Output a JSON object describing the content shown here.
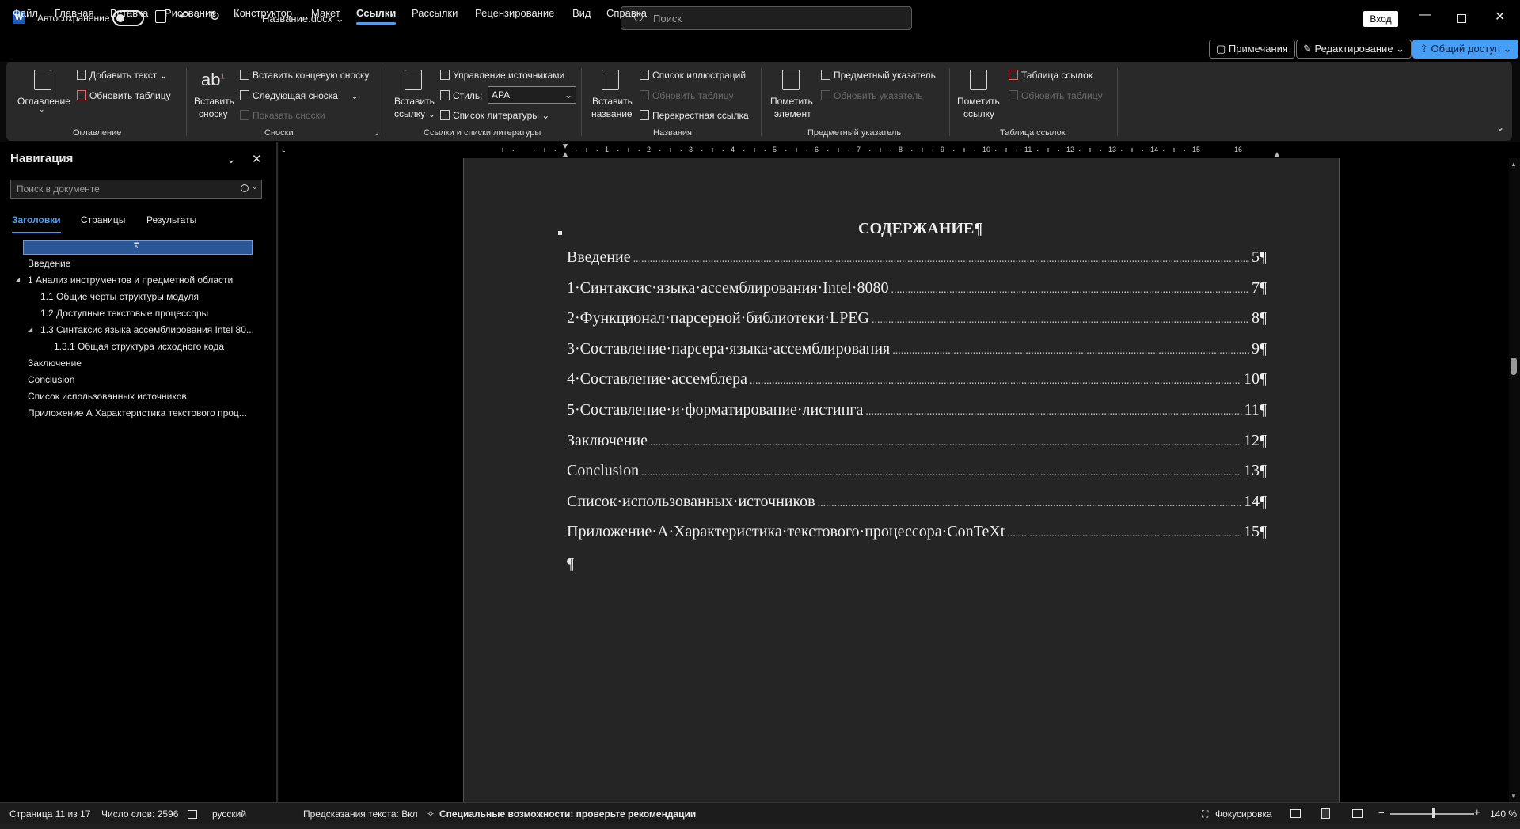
{
  "titlebar": {
    "logo": "W",
    "autosave_label": "Автосохранение",
    "doc_name": "Название.docx",
    "search_placeholder": "Поиск",
    "login": "Вход"
  },
  "menu": {
    "items": [
      "Файл",
      "Главная",
      "Вставка",
      "Рисование",
      "Конструктор",
      "Макет",
      "Ссылки",
      "Рассылки",
      "Рецензирование",
      "Вид",
      "Справка"
    ],
    "active": "Ссылки",
    "comments": "Примечания",
    "editing": "Редактирование",
    "share": "Общий доступ"
  },
  "ribbon": {
    "toc": {
      "big": "Оглавление",
      "add_text": "Добавить текст",
      "update": "Обновить таблицу",
      "group": "Оглавление"
    },
    "footnotes": {
      "insert_1": "Вставить",
      "insert_2": "сноску",
      "endnote": "Вставить концевую сноску",
      "next": "Следующая сноска",
      "show": "Показать сноски",
      "group": "Сноски"
    },
    "citations": {
      "insert_1": "Вставить",
      "insert_2": "ссылку",
      "manage": "Управление источниками",
      "style_label": "Стиль:",
      "style_value": "APA",
      "bibliography": "Список литературы",
      "group": "Ссылки и списки литературы"
    },
    "captions": {
      "insert_1": "Вставить",
      "insert_2": "название",
      "figures": "Список иллюстраций",
      "update": "Обновить таблицу",
      "cross": "Перекрестная ссылка",
      "group": "Названия"
    },
    "index": {
      "mark_1": "Пометить",
      "mark_2": "элемент",
      "insert": "Предметный указатель",
      "update": "Обновить указатель",
      "group": "Предметный указатель"
    },
    "toa": {
      "mark_1": "Пометить",
      "mark_2": "ссылку",
      "insert": "Таблица ссылок",
      "update": "Обновить таблицу",
      "group": "Таблица ссылок"
    }
  },
  "nav": {
    "title": "Навигация",
    "search_placeholder": "Поиск в документе",
    "tabs": [
      "Заголовки",
      "Страницы",
      "Результаты"
    ],
    "items": [
      {
        "label": "Введение"
      },
      {
        "label": "1 Анализ инструментов и предметной области"
      },
      {
        "label": "1.1 Общие черты структуры модуля"
      },
      {
        "label": "1.2 Доступные текстовые процессоры"
      },
      {
        "label": "1.3 Синтаксис языка ассемблирования Intel 80..."
      },
      {
        "label": "1.3.1 Общая структура исходного кода"
      },
      {
        "label": "Заключение"
      },
      {
        "label": "Conclusion"
      },
      {
        "label": "Список использованных источников"
      },
      {
        "label": "Приложение А  Характеристика текстового проц..."
      }
    ]
  },
  "ruler_numbers": [
    "1",
    "2",
    "3",
    "4",
    "5",
    "6",
    "7",
    "8",
    "9",
    "10",
    "11",
    "12",
    "13",
    "14",
    "15",
    "16"
  ],
  "document": {
    "title": "СОДЕРЖАНИЕ¶",
    "toc": [
      {
        "text": "Введение",
        "page": "5¶"
      },
      {
        "text": "1·Синтаксис·языка·ассемблирования·Intel·8080",
        "page": "7¶"
      },
      {
        "text": "2·Функционал·парсерной·библиотеки·LPEG",
        "page": "8¶"
      },
      {
        "text": "3·Составление·парсера·языка·ассемблирования",
        "page": "9¶"
      },
      {
        "text": "4·Составление·ассемблера",
        "page": "10¶"
      },
      {
        "text": "5·Составление·и·форматирование·листинга",
        "page": "11¶"
      },
      {
        "text": "Заключение",
        "page": "12¶"
      },
      {
        "text": "Conclusion",
        "page": "13¶"
      },
      {
        "text": "Список·использованных·источников",
        "page": "14¶"
      },
      {
        "text": "Приложение·А·Характеристика·текстового·процессора·ConTeXt",
        "page": "15¶"
      }
    ],
    "empty_para": "¶"
  },
  "status": {
    "page": "Страница 11 из 17",
    "words": "Число слов: 2596",
    "language": "русский",
    "prediction": "Предсказания текста: Вкл",
    "accessibility": "Специальные возможности: проверьте рекомендации",
    "focus": "Фокусировка",
    "zoom_minus": "−",
    "zoom_plus": "+",
    "zoom": "140 %"
  },
  "colors": {
    "accent": "#4f9cf0",
    "share": "#479ef5",
    "nav_highlight": "#2b5797"
  }
}
